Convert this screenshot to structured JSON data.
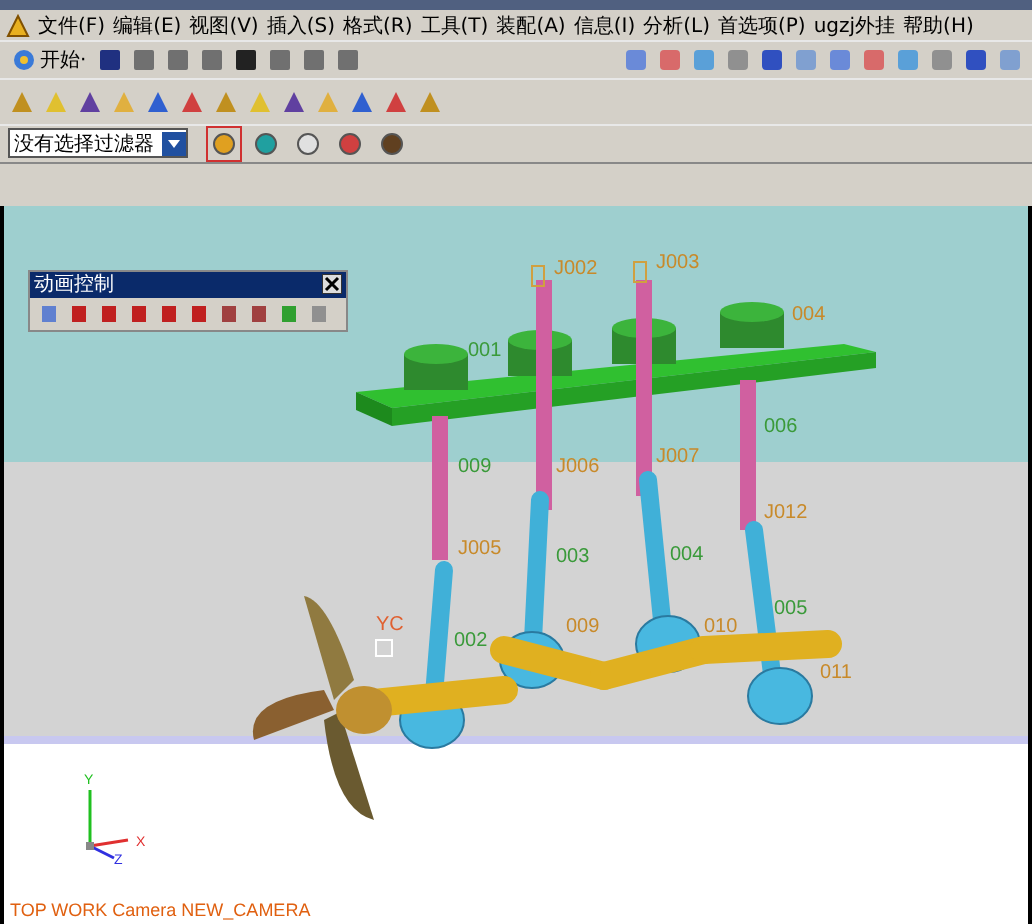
{
  "menu_bar": [
    {
      "label": "文件(F)"
    },
    {
      "label": "编辑(E)"
    },
    {
      "label": "视图(V)"
    },
    {
      "label": "插入(S)"
    },
    {
      "label": "格式(R)"
    },
    {
      "label": "工具(T)"
    },
    {
      "label": "装配(A)"
    },
    {
      "label": "信息(I)"
    },
    {
      "label": "分析(L)"
    },
    {
      "label": "首选项(P)"
    },
    {
      "label": "ugzj外挂"
    },
    {
      "label": "帮助(H)"
    }
  ],
  "toolbar": {
    "start_button": "开始·"
  },
  "selection_filter": {
    "value": "没有选择过滤器"
  },
  "animation_panel": {
    "title": "动画控制"
  },
  "viewport": {
    "labels": [
      {
        "text": "001"
      },
      {
        "text": "J002"
      },
      {
        "text": "J003"
      },
      {
        "text": "004"
      },
      {
        "text": "006"
      },
      {
        "text": "009"
      },
      {
        "text": "J006"
      },
      {
        "text": "J007"
      },
      {
        "text": "J012"
      },
      {
        "text": "J005"
      },
      {
        "text": "003"
      },
      {
        "text": "004"
      },
      {
        "text": "005"
      },
      {
        "text": "002"
      },
      {
        "text": "009"
      },
      {
        "text": "010"
      },
      {
        "text": "011"
      },
      {
        "text": "YC"
      }
    ],
    "triad": {
      "x": "X",
      "y": "Y",
      "z": "Z"
    },
    "camera_status": "TOP WORK Camera NEW_CAMERA"
  }
}
